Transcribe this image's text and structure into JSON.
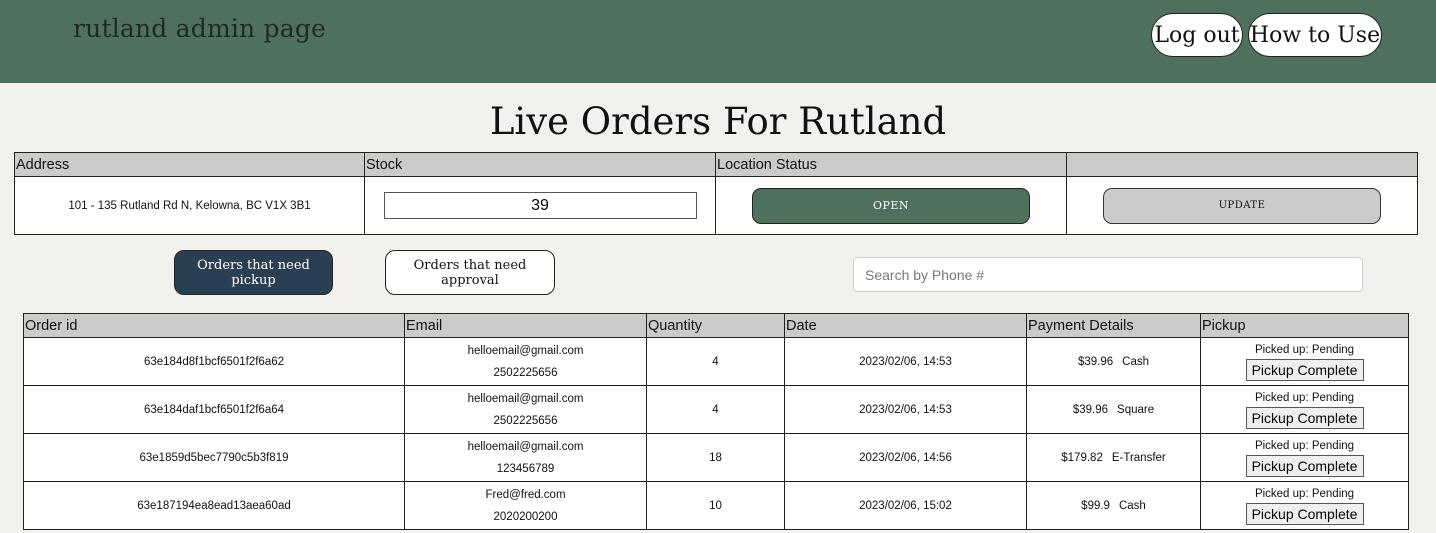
{
  "header": {
    "brand": "rutland admin page",
    "logout_label": "Log out",
    "howto_label": "How to Use"
  },
  "page_title": "Live Orders For Rutland",
  "location_table": {
    "headers": [
      "Address",
      "Stock",
      "Location Status",
      ""
    ],
    "address": "101 - 135 Rutland Rd N, Kelowna, BC V1X 3B1",
    "stock_value": "39",
    "status_label": "OPEN",
    "update_label": "UPDATE"
  },
  "tabs": {
    "pickup_label": "Orders that need pickup",
    "approval_label": "Orders that need approval"
  },
  "search": {
    "placeholder": "Search by Phone #"
  },
  "orders_table": {
    "headers": [
      "Order id",
      "Email",
      "Quantity",
      "Date",
      "Payment Details",
      "Pickup"
    ],
    "rows": [
      {
        "id": "63e184d8f1bcf6501f2f6a62",
        "email": "helloemail@gmail.com",
        "phone": "2502225656",
        "quantity": "4",
        "date": "2023/02/06, 14:53",
        "amount": "$39.96",
        "method": "Cash",
        "picked": "Picked up: Pending",
        "action": "Pickup Complete"
      },
      {
        "id": "63e184daf1bcf6501f2f6a64",
        "email": "helloemail@gmail.com",
        "phone": "2502225656",
        "quantity": "4",
        "date": "2023/02/06, 14:53",
        "amount": "$39.96",
        "method": "Square",
        "picked": "Picked up: Pending",
        "action": "Pickup Complete"
      },
      {
        "id": "63e1859d5bec7790c5b3f819",
        "email": "helloemail@gmail.com",
        "phone": "123456789",
        "quantity": "18",
        "date": "2023/02/06, 14:56",
        "amount": "$179.82",
        "method": "E-Transfer",
        "picked": "Picked up: Pending",
        "action": "Pickup Complete"
      },
      {
        "id": "63e187194ea8ead13aea60ad",
        "email": "Fred@fred.com",
        "phone": "2020200200",
        "quantity": "10",
        "date": "2023/02/06, 15:02",
        "amount": "$99.9",
        "method": "Cash",
        "picked": "Picked up: Pending",
        "action": "Pickup Complete"
      }
    ]
  }
}
